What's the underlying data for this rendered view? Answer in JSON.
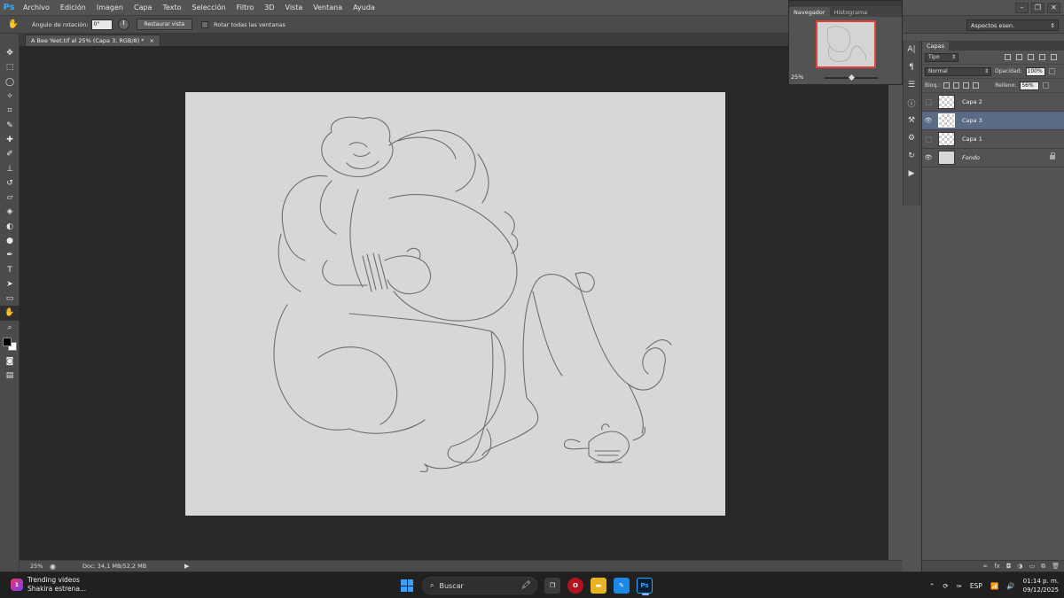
{
  "app": {
    "logo": "Ps"
  },
  "menu": [
    "Archivo",
    "Edición",
    "Imagen",
    "Capa",
    "Texto",
    "Selección",
    "Filtro",
    "3D",
    "Vista",
    "Ventana",
    "Ayuda"
  ],
  "window_controls": {
    "minimize": "–",
    "restore": "❐",
    "close": "✕"
  },
  "options": {
    "rotation_label": "Ángulo de rotación:",
    "rotation_value": "0°",
    "reset_view_label": "Restaurar vista",
    "rotate_all_label": "Rotar todas las ventanas",
    "workspace": "Aspectos esen."
  },
  "document": {
    "tab_title": "A Bee Yeet.tif al 25% (Capa 3, RGB/8) *",
    "tab_close": "×",
    "canvas_bg": "#d7d7d7"
  },
  "status": {
    "zoom": "25%",
    "doc_info": "Doc: 34,1 MB/52,2 MB"
  },
  "navigator": {
    "tabs": [
      "Navegador",
      "Histograma"
    ],
    "active_tab": 0,
    "zoom": "25%",
    "viewbox_color": "#e0413b"
  },
  "layers_panel": {
    "tab": "Capas",
    "filter_kind": "Tipo",
    "blend_mode": "Normal",
    "opacity_label": "Opacidad:",
    "opacity_value": "100%",
    "lock_label": "Bloq.:",
    "fill_label": "Relleno:",
    "fill_value": "56%",
    "layers": [
      {
        "name": "Capa 2",
        "visible": false,
        "selected": false,
        "type": "transparent"
      },
      {
        "name": "Capa 3",
        "visible": true,
        "selected": true,
        "type": "transparent"
      },
      {
        "name": "Capa 1",
        "visible": false,
        "selected": false,
        "type": "transparent"
      },
      {
        "name": "Fondo",
        "visible": true,
        "selected": false,
        "type": "solid",
        "locked": true
      }
    ]
  },
  "taskbar": {
    "news_title": "Trending videos",
    "news_subtitle": "Shakira estrena...",
    "news_badge": "1",
    "search_placeholder": "Buscar",
    "language": "ESP",
    "time": "01:14 p. m.",
    "date": "09/12/2025"
  }
}
